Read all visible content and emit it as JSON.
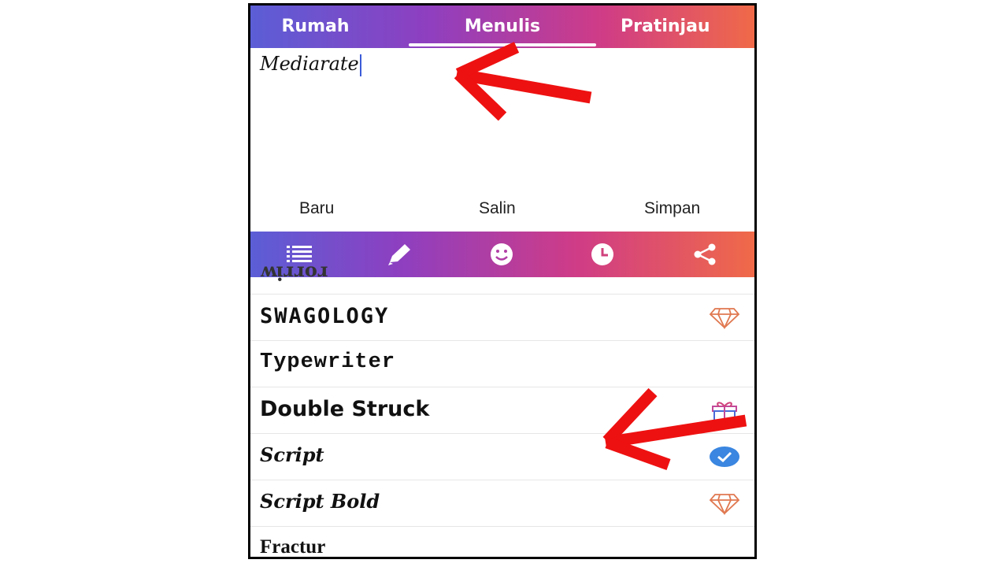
{
  "tabs": {
    "home": "Rumah",
    "write": "Menulis",
    "preview": "Pratinjau"
  },
  "editor": {
    "text": "Mediarate"
  },
  "actions": {
    "new": "Baru",
    "copy": "Salin",
    "save": "Simpan"
  },
  "toolbar": {
    "icons": [
      "list-icon",
      "pencil-icon",
      "smiley-icon",
      "clock-icon",
      "share-icon"
    ]
  },
  "fonts": {
    "partial": "ʍᴉɹɹoɹ",
    "swagology": "SWAGOLOGY",
    "typewriter": "Typewriter",
    "double_struck": "Double Struck",
    "script": "Script",
    "script_bold": "Script Bold",
    "fractur": "Fractur"
  },
  "colors": {
    "gradient_start": "#5b5ed6",
    "gradient_end": "#f06a48",
    "check": "#3a86e0",
    "diamond": "#e07850",
    "annotation_arrow": "#ee1111"
  }
}
